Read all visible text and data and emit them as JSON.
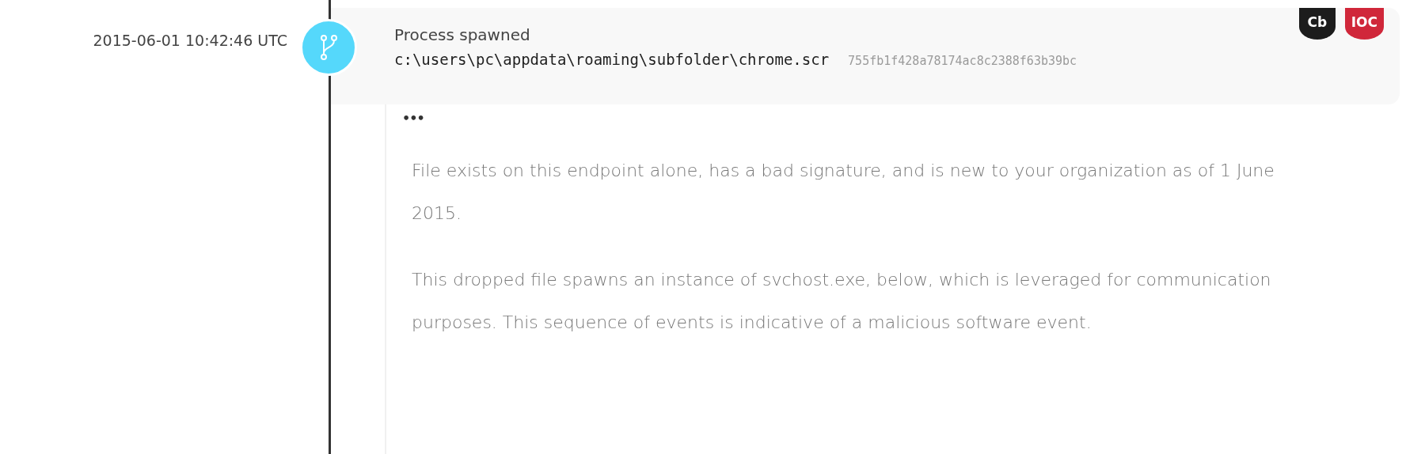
{
  "event": {
    "timestamp": "2015-06-01 10:42:46 UTC",
    "title": "Process spawned",
    "path": "c:\\users\\pc\\appdata\\roaming\\subfolder\\chrome.scr",
    "hash": "755fb1f428a78174ac8c2388f63b39bc",
    "badges": [
      {
        "label": "Cb",
        "color": "#1c1c1c"
      },
      {
        "label": "IOC",
        "color": "#d0273a"
      }
    ],
    "detail": {
      "more": "•••",
      "paragraphs": [
        "File exists on this endpoint alone, has a bad signature, and is new to your organization as of 1 June 2015.",
        "This dropped file spawns an instance of svchost.exe, below, which is leveraged for communication purposes. This sequence of events is indicative of a malicious software event."
      ]
    }
  }
}
